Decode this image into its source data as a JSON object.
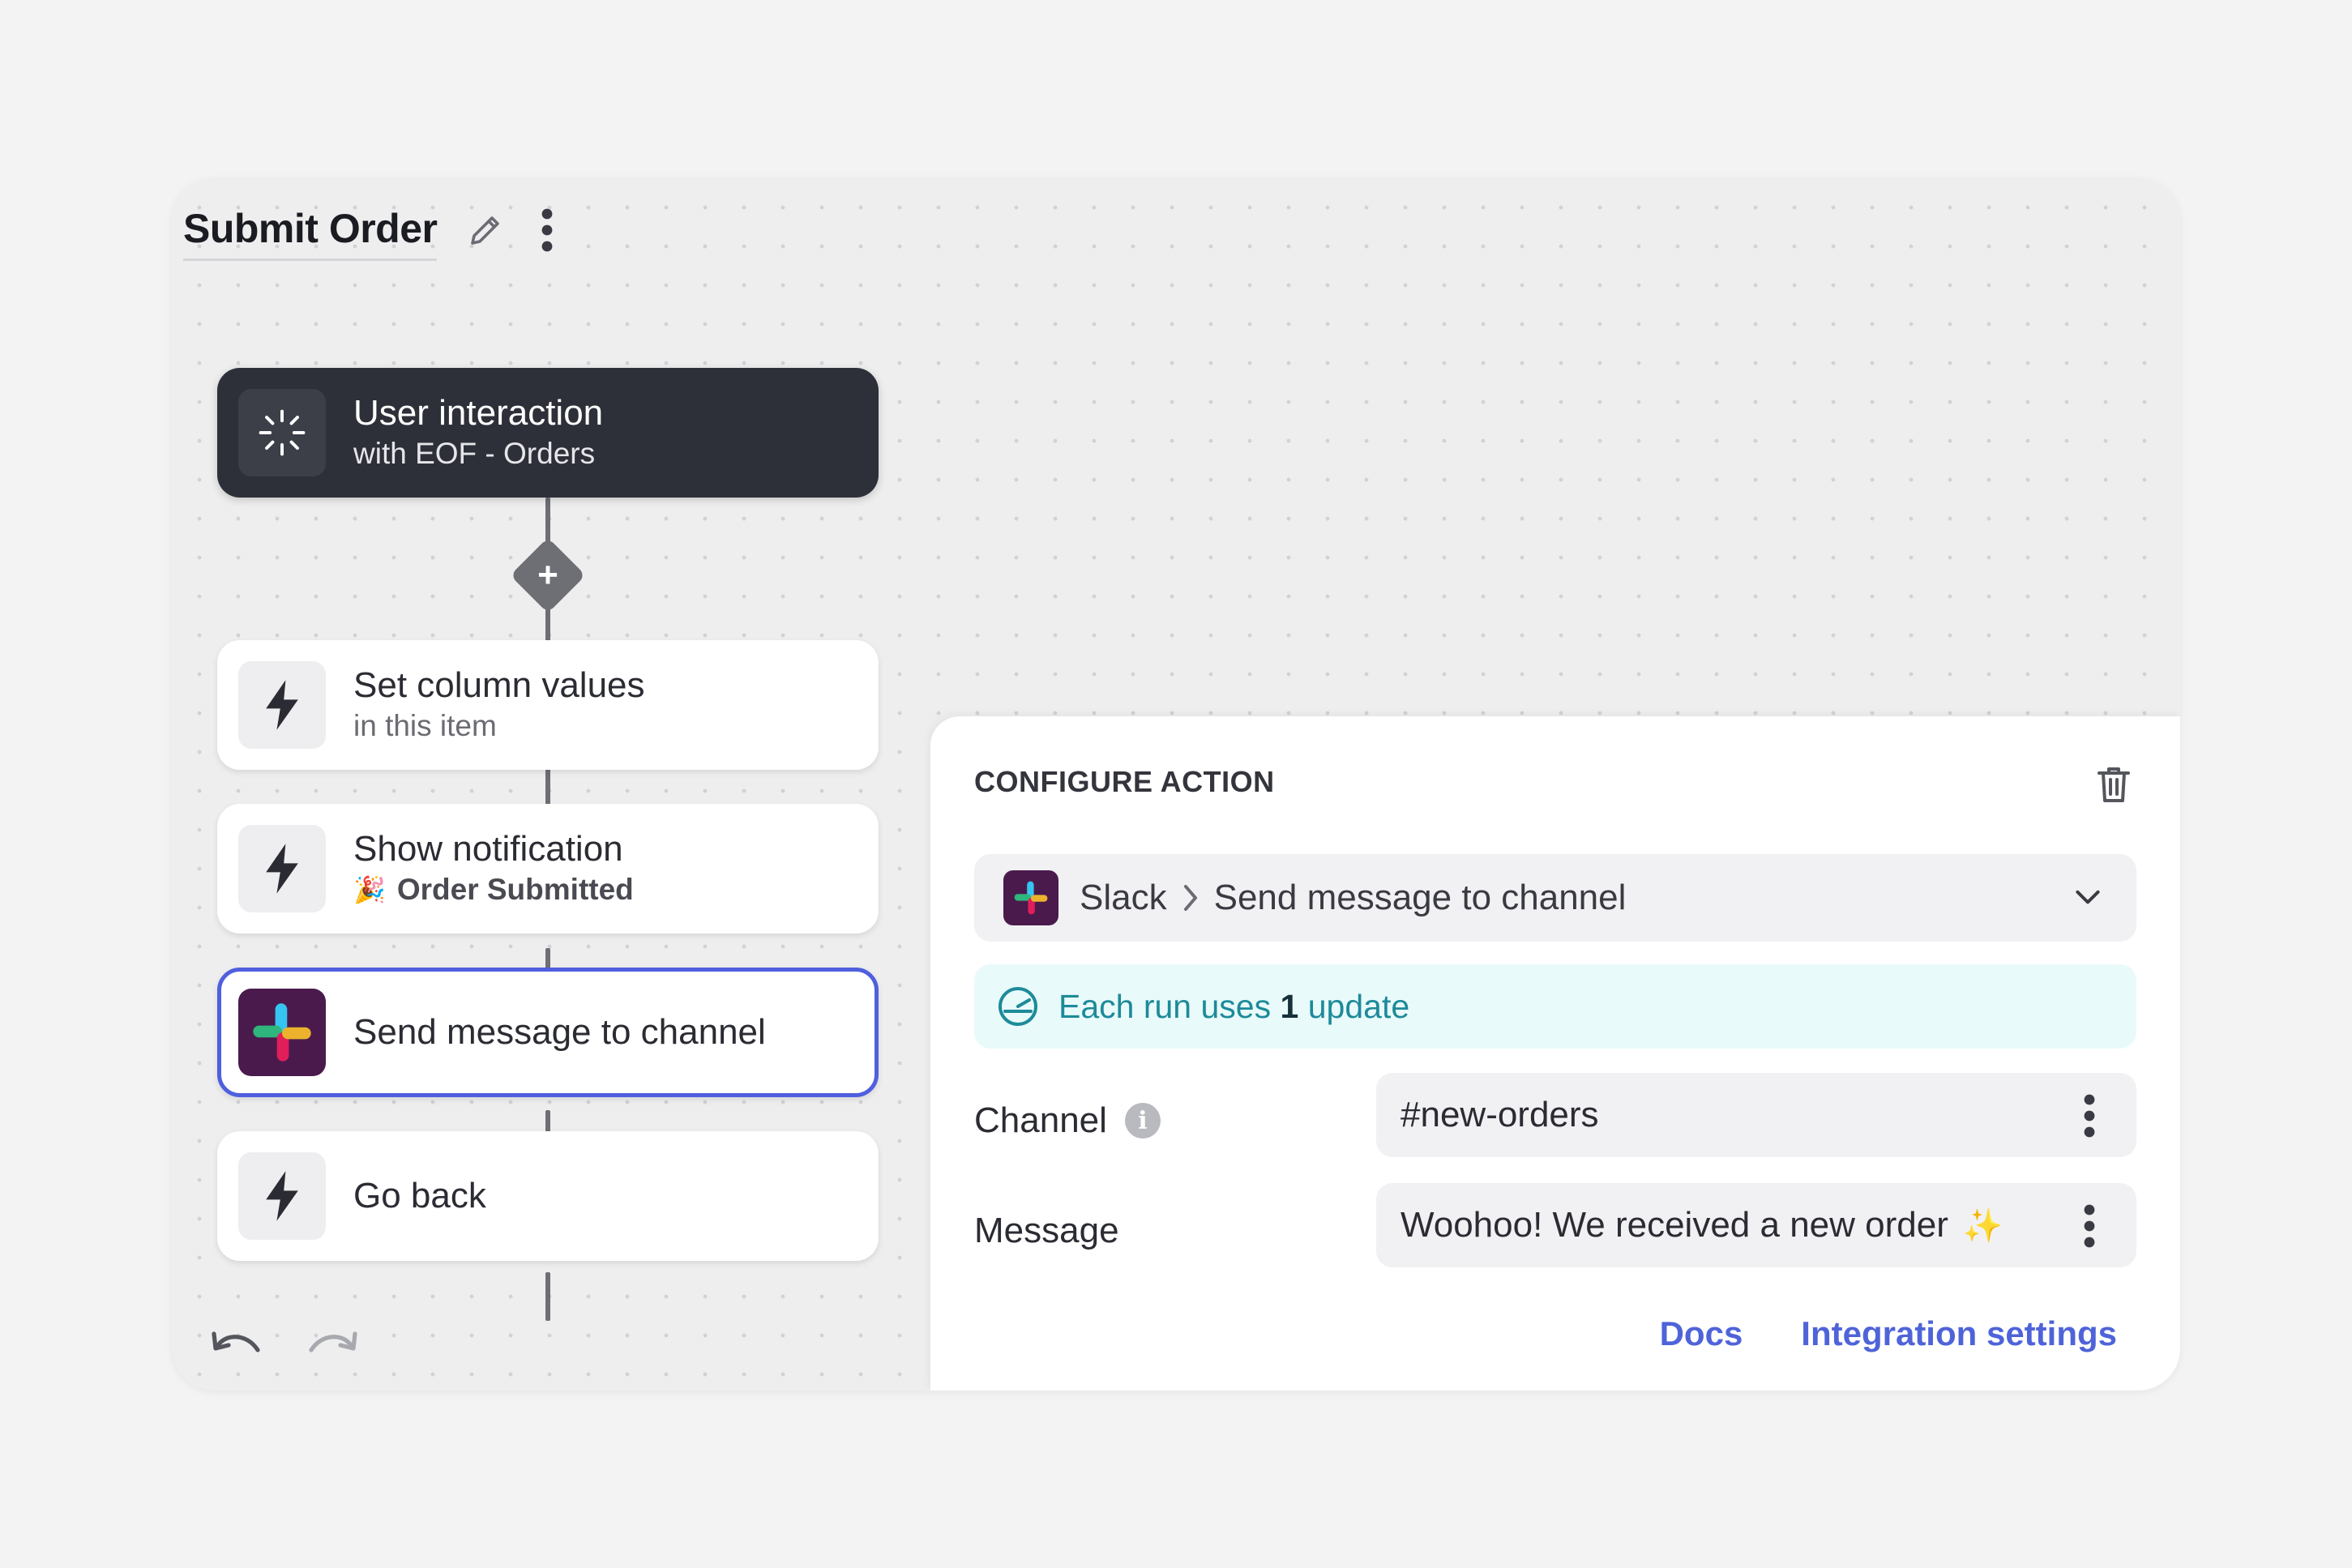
{
  "workflow": {
    "title": "Submit Order"
  },
  "nodes": [
    {
      "title": "User interaction",
      "subtitle": "with EOF - Orders",
      "icon": "sparkle-burst-icon"
    },
    {
      "title": "Set column values",
      "subtitle": "in this item",
      "icon": "lightning-icon"
    },
    {
      "title": "Show notification",
      "subtitle": "Order Submitted",
      "icon": "lightning-icon"
    },
    {
      "title": "Send message to channel",
      "subtitle": "",
      "icon": "slack-icon"
    },
    {
      "title": "Go back",
      "subtitle": "",
      "icon": "lightning-icon"
    }
  ],
  "panel": {
    "header": "CONFIGURE ACTION",
    "action": {
      "app": "Slack",
      "name": "Send message to channel"
    },
    "usage": {
      "prefix": "Each run uses",
      "count": "1",
      "suffix": "update"
    },
    "fields": [
      {
        "label": "Channel",
        "value": "#new-orders"
      },
      {
        "label": "Message",
        "value": "Woohoo! We received a new order"
      }
    ],
    "links": {
      "docs": "Docs",
      "integration_settings": "Integration settings"
    }
  },
  "colors": {
    "accent": "#4f5fde",
    "trigger_bg": "#2e3039",
    "usage_bg": "#e9fafb",
    "usage_text": "#1d8a99",
    "link": "#4f63d9",
    "slack_bg": "#4a1a4d"
  }
}
